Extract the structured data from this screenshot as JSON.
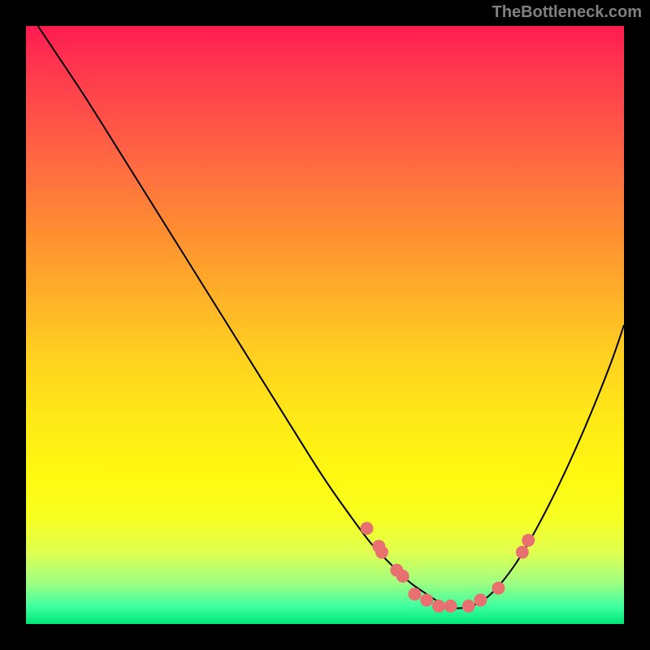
{
  "attribution": "TheBottleneck.com",
  "chart_data": {
    "type": "line",
    "title": "",
    "xlabel": "",
    "ylabel": "",
    "xlim": [
      0,
      100
    ],
    "ylim": [
      0,
      100
    ],
    "curve": {
      "x": [
        2,
        6,
        10,
        15,
        20,
        25,
        30,
        35,
        40,
        45,
        50,
        55,
        58,
        61,
        64,
        67,
        70,
        72,
        75,
        78,
        82,
        86,
        90,
        94,
        98,
        100
      ],
      "y": [
        100,
        94,
        88,
        80,
        72,
        64,
        56,
        48,
        40,
        32,
        24,
        17,
        13,
        10,
        7,
        5,
        3,
        2.5,
        3,
        5,
        10,
        17,
        25,
        34,
        44,
        50
      ]
    },
    "series": [
      {
        "name": "highlighted-points",
        "x": [
          57,
          59,
          59.5,
          62,
          63,
          65,
          67,
          69,
          71,
          74,
          76,
          79,
          83,
          84
        ],
        "y": [
          16,
          13,
          12,
          9,
          8,
          5,
          4,
          3,
          3,
          3,
          4,
          6,
          12,
          14
        ]
      }
    ]
  }
}
